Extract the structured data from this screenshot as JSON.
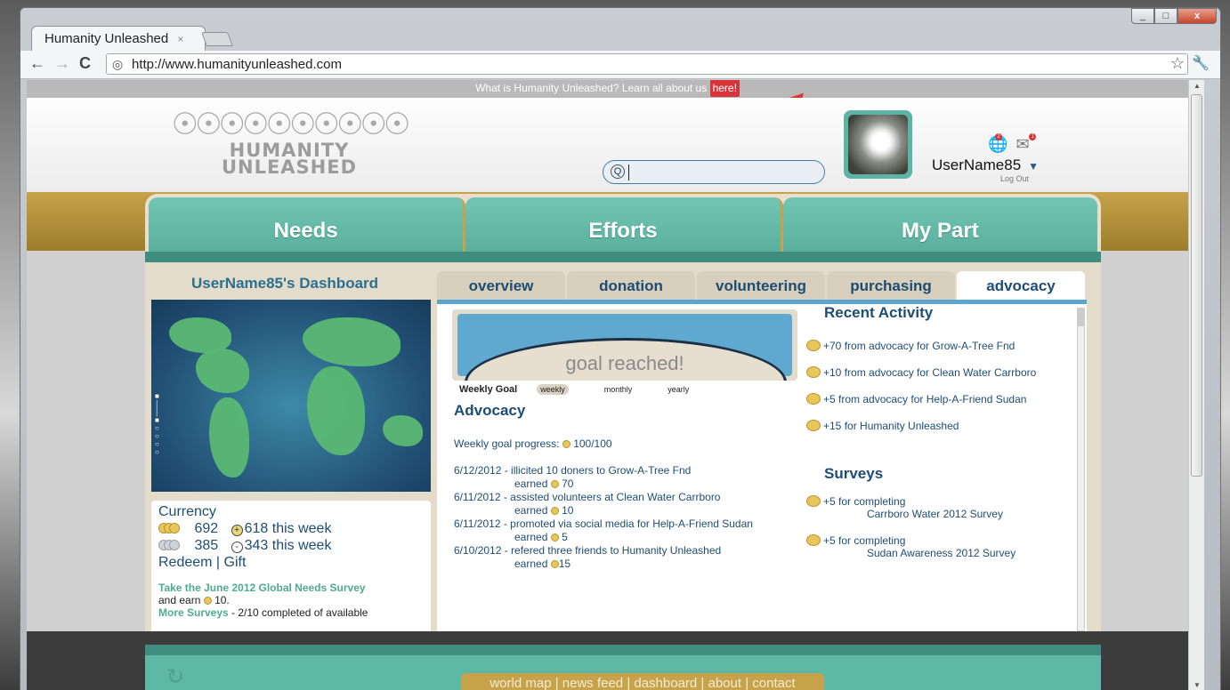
{
  "browser": {
    "tab_title": "Humanity Unleashed",
    "tab_close": "×",
    "url": "http://www.humanityunleashed.com",
    "controls": {
      "minimize": "_",
      "maximize": "□",
      "close": "x"
    }
  },
  "site": {
    "banner_text": "What is Humanity Unleashed? Learn all about us ",
    "banner_link": "here!",
    "logo_line1": "HUMANITY",
    "logo_line2": "UNLEASHED",
    "search_placeholder": "",
    "username": "UserName85",
    "logout": "Log Out",
    "notification_count_1": "2",
    "notification_count_2": "1"
  },
  "nav": {
    "items": [
      {
        "label": "Needs"
      },
      {
        "label": "Efforts"
      },
      {
        "label": "My Part"
      }
    ]
  },
  "dashboard": {
    "title": "UserName85's Dashboard",
    "currency": {
      "title": "Currency",
      "gold_total": "692",
      "gold_week": "618 this week",
      "silver_total": "385",
      "silver_week": "343 this week",
      "redeem": "Redeem",
      "separator": " | ",
      "gift": "Gift"
    },
    "survey_promo": {
      "link": "Take the June 2012 Global Needs Survey",
      "earn_prefix": "and earn",
      "earn_value": "10.",
      "more_link": "More Surveys",
      "more_text": " - 2/10 completed of available"
    }
  },
  "subtabs": [
    {
      "label": "overview",
      "active": false
    },
    {
      "label": "donation",
      "active": false
    },
    {
      "label": "volunteering",
      "active": false
    },
    {
      "label": "purchasing",
      "active": false
    },
    {
      "label": "advocacy",
      "active": true
    }
  ],
  "advocacy": {
    "goal_text": "goal reached!",
    "goal_progress": 1.0,
    "goal_label": "Weekly Goal",
    "goal_options": [
      "weekly",
      "monthly",
      "yearly"
    ],
    "section_title": "Advocacy",
    "progress_label": "Weekly goal progress:",
    "progress_value": "100/100",
    "entries": [
      {
        "text": "6/12/2012 - illicited 10 doners to Grow-A-Tree Fnd",
        "earned": "earned",
        "value": "70"
      },
      {
        "text": "6/11/2012 - assisted volunteers at Clean Water Carrboro",
        "earned": "earned",
        "value": "10"
      },
      {
        "text": "6/11/2012 - promoted via social media for Help-A-Friend Sudan",
        "earned": "earned",
        "value": "5"
      },
      {
        "text": "6/10/2012 - refered three friends to Humanity Unleashed",
        "earned": "earned",
        "value": "15"
      }
    ]
  },
  "recent_activity": {
    "title": "Recent Activity",
    "items": [
      "+70 from advocacy for Grow-A-Tree Fnd",
      "+10 from advocacy for Clean Water Carrboro",
      "+5 from advocacy for Help-A-Friend Sudan",
      "+15 for Humanity Unleashed"
    ]
  },
  "surveys": {
    "title": "Surveys",
    "items": [
      {
        "line1": "+5 for completing",
        "line2": "Carrboro Water 2012 Survey"
      },
      {
        "line1": "+5 for completing",
        "line2": "Sudan Awareness 2012 Survey"
      }
    ]
  },
  "footer": {
    "links": "world map | news feed | dashboard | about | contact"
  }
}
